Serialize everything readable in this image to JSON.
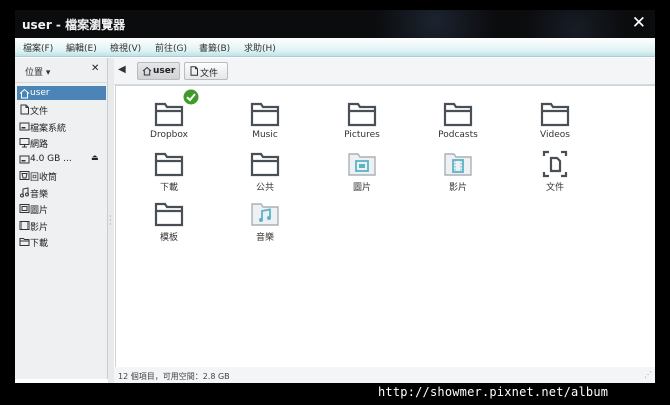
{
  "window": {
    "title": "user - 檔案瀏覽器"
  },
  "menu": [
    {
      "label": "檔案(F)"
    },
    {
      "label": "編輯(E)"
    },
    {
      "label": "檢視(V)"
    },
    {
      "label": "前往(G)"
    },
    {
      "label": "書籤(B)"
    },
    {
      "label": "求助(H)"
    }
  ],
  "sidebar": {
    "header_label": "位置",
    "items": [
      {
        "label": "user",
        "icon": "home-icon",
        "selected": true
      },
      {
        "label": "文件",
        "icon": "document-icon"
      },
      {
        "label": "檔案系統",
        "icon": "drive-icon"
      },
      {
        "label": "網路",
        "icon": "network-icon"
      },
      {
        "label": "4.0 GB ...",
        "icon": "drive-icon",
        "eject": true
      },
      {
        "label": "回收筒",
        "icon": "trash-icon"
      },
      {
        "label": "音樂",
        "icon": "music-icon"
      },
      {
        "label": "圖片",
        "icon": "pictures-icon"
      },
      {
        "label": "影片",
        "icon": "video-icon"
      },
      {
        "label": "下載",
        "icon": "download-icon"
      }
    ]
  },
  "breadcrumbs": [
    {
      "label": "user",
      "icon": "home-icon",
      "active": true
    },
    {
      "label": "文件",
      "icon": "document-icon"
    }
  ],
  "files": [
    {
      "label": "Dropbox",
      "icon": "folder-icon",
      "badge": "check-badge-icon"
    },
    {
      "label": "Music",
      "icon": "folder-icon"
    },
    {
      "label": "Pictures",
      "icon": "folder-icon"
    },
    {
      "label": "Podcasts",
      "icon": "folder-icon"
    },
    {
      "label": "Videos",
      "icon": "folder-icon"
    },
    {
      "label": "下載",
      "icon": "folder-icon"
    },
    {
      "label": "公共",
      "icon": "folder-icon"
    },
    {
      "label": "圖片",
      "icon": "pictures-folder-icon"
    },
    {
      "label": "影片",
      "icon": "video-folder-icon"
    },
    {
      "label": "文件",
      "icon": "document-icon"
    },
    {
      "label": "模板",
      "icon": "folder-icon"
    },
    {
      "label": "音樂",
      "icon": "music-folder-icon"
    }
  ],
  "status": {
    "text": "12 個項目，可用空間：2.8 GB"
  },
  "watermark": "http://showmer.pixnet.net/album",
  "colors": {
    "selection": "#4a85b5",
    "accent": "#5bb3c6",
    "folder": "#4a4f55",
    "badge": "#3e9a2a"
  }
}
